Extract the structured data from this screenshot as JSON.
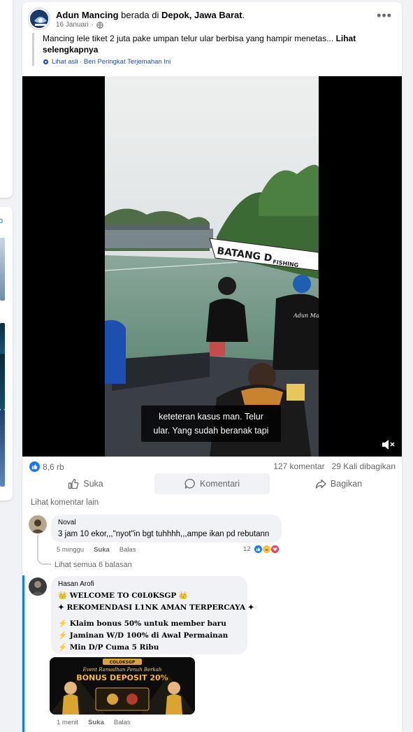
{
  "post": {
    "author": "Adun Mancing",
    "location_prefix": "berada di",
    "location": "Depok, Jawa Barat",
    "location_suffix": ".",
    "date": "16 Januari",
    "privacy_separator": "·",
    "more_menu": "•••",
    "text": "Mancing lele tiket 2 juta pake umpan telur ular berbisa yang hampir menetas... ",
    "see_more": "Lihat selengkapnya",
    "translation_note": "Lihat asli · Beri Peringkat Terjemahan Ini"
  },
  "video": {
    "caption_line1": "keteteran kasus man. Telur",
    "caption_line2": "ular. Yang sudah beranak tapi",
    "banner_text": "BATANG D",
    "banner_sub": "FISHING",
    "shirt_text": "Adun Mancing",
    "muted": true
  },
  "stats": {
    "likes": "8,6 rb",
    "comments": "127 komentar",
    "shares": "29 Kali dibagikan"
  },
  "actions": {
    "like": "Suka",
    "comment": "Komentari",
    "share": "Bagikan"
  },
  "comments_section": {
    "see_more": "Lihat komentar lain"
  },
  "comments": [
    {
      "name": "Noval",
      "text": "3 jam 10 ekor,,,\"nyot\"in bgt tuhhhh,,,ampe ikan pd rebutann",
      "time": "5 minggu",
      "like": "Suka",
      "reply": "Balas",
      "reaction_count": "12",
      "view_replies": "Lihat semua 6 balasan"
    },
    {
      "name": "Hasan Arofi",
      "lines": [
        "👑 WELCOME TO C0L0KSGP 👑",
        "✦ REKOMENDASI L1NK AMAN TERPERCAYA ✦",
        "⚡ Klaim bonus 50% untuk member baru",
        "⚡ Jaminan W/D 100% di Awal Permainan",
        "⚡ Min D/P Cuma 5 Ribu"
      ],
      "banner_title": "BONUS DEPOSIT 20%",
      "banner_sub": "Event Ramadhan Penuh Berkah",
      "banner_brand": "COLOKSGP",
      "time": "1 menit",
      "like": "Suka",
      "reply": "Balas"
    }
  ],
  "colors": {
    "accent": "#1877f2",
    "muted_text": "#65676b",
    "bubble": "#f0f2f5"
  }
}
